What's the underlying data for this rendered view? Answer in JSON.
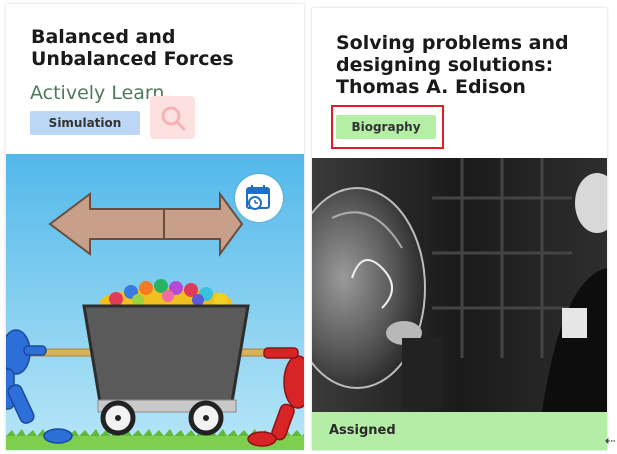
{
  "cards": [
    {
      "title": "Balanced and Unbalanced Forces",
      "provider": "Actively Learn",
      "type_badge": "Simulation",
      "search_icon": "search-icon",
      "calendar_icon": "calendar-clock-icon",
      "colors": {
        "badge": "#bcd7f4",
        "provider": "#4f7a5a"
      }
    },
    {
      "title": "Solving problems and designing solutions: Thomas A. Edison",
      "type_badge": "Biography",
      "status": "Assigned",
      "colors": {
        "badge": "#b5efa6",
        "status": "#b4eda5",
        "highlight": "#e01b24"
      }
    }
  ]
}
